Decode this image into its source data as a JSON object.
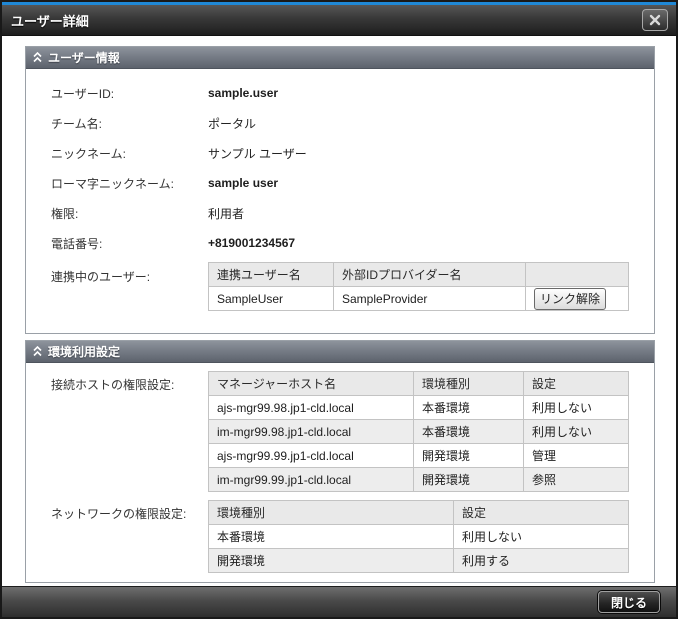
{
  "colors": {
    "accent_blue": "#1f88d6",
    "titlebar_dark": "#2a2a2a",
    "section_header_gray": "#747a84",
    "table_header_bg": "#e9e9e9",
    "row_alt_bg": "#ededed"
  },
  "dialog": {
    "title": "ユーザー詳細"
  },
  "user_info": {
    "title": "ユーザー情報",
    "fields": [
      {
        "label": "ユーザーID:",
        "value": "sample.user"
      },
      {
        "label": "チーム名:",
        "value": "ポータル"
      },
      {
        "label": "ニックネーム:",
        "value": "サンプル ユーザー"
      },
      {
        "label": "ローマ字ニックネーム:",
        "value": "sample user"
      },
      {
        "label": "権限:",
        "value": "利用者"
      },
      {
        "label": "電話番号:",
        "value": "+819001234567"
      }
    ],
    "linked": {
      "label": "連携中のユーザー:",
      "headers": [
        "連携ユーザー名",
        "外部IDプロバイダー名",
        ""
      ],
      "row": {
        "user": "SampleUser",
        "provider": "SampleProvider",
        "action": "リンク解除"
      }
    }
  },
  "env": {
    "title": "環境利用設定",
    "hosts": {
      "label": "接続ホストの権限設定:",
      "headers": [
        "マネージャーホスト名",
        "環境種別",
        "設定"
      ],
      "rows": [
        [
          "ajs-mgr99.98.jp1-cld.local",
          "本番環境",
          "利用しない"
        ],
        [
          "im-mgr99.98.jp1-cld.local",
          "本番環境",
          "利用しない"
        ],
        [
          "ajs-mgr99.99.jp1-cld.local",
          "開発環境",
          "管理"
        ],
        [
          "im-mgr99.99.jp1-cld.local",
          "開発環境",
          "参照"
        ]
      ]
    },
    "network": {
      "label": "ネットワークの権限設定:",
      "headers": [
        "環境種別",
        "設定"
      ],
      "rows": [
        [
          "本番環境",
          "利用しない"
        ],
        [
          "開発環境",
          "利用する"
        ]
      ]
    }
  },
  "footer": {
    "close": "閉じる"
  }
}
